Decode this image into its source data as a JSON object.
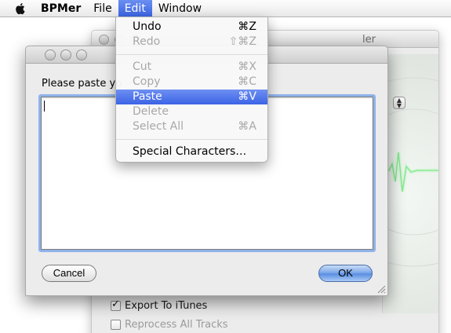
{
  "menubar": {
    "app_name": "BPMer",
    "items": [
      "File",
      "Edit",
      "Window"
    ]
  },
  "edit_menu": {
    "items": [
      {
        "label": "Undo",
        "shortcut": "⌘Z",
        "enabled": true
      },
      {
        "label": "Redo",
        "shortcut": "⇧⌘Z",
        "enabled": false
      },
      {
        "label": "Cut",
        "shortcut": "⌘X",
        "enabled": false
      },
      {
        "label": "Copy",
        "shortcut": "⌘C",
        "enabled": false
      },
      {
        "label": "Paste",
        "shortcut": "⌘V",
        "enabled": true,
        "highlighted": true
      },
      {
        "label": "Delete",
        "shortcut": "",
        "enabled": false
      },
      {
        "label": "Select All",
        "shortcut": "⌘A",
        "enabled": false
      },
      {
        "label": "Special Characters…",
        "shortcut": "",
        "enabled": true
      }
    ]
  },
  "background_window": {
    "title_fragment": "ler",
    "checkboxes": [
      {
        "label": "Export To iTunes",
        "checked": true
      },
      {
        "label": "Reprocess All Tracks",
        "checked": false
      }
    ]
  },
  "sheet": {
    "prompt": "Please paste yo",
    "textarea_value": "",
    "cancel_label": "Cancel",
    "ok_label": "OK"
  },
  "colors": {
    "highlight": "#3c63e5",
    "focus_ring": "#8fb3ea",
    "heartbeat": "#6fe27a"
  }
}
